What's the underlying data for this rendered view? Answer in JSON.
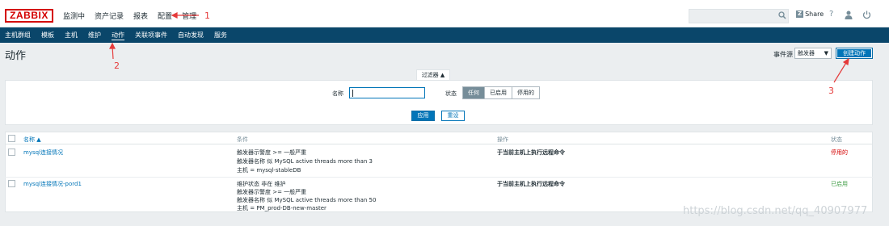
{
  "topbar": {
    "logo": "ZABBIX",
    "menu": [
      "监测中",
      "资产记录",
      "报表",
      "配置",
      "管理"
    ],
    "share_label": "Share",
    "share_badge": "Z",
    "help": "?"
  },
  "subnav": [
    "主机群组",
    "模板",
    "主机",
    "维护",
    "动作",
    "关联项事件",
    "自动发现",
    "服务"
  ],
  "page": {
    "title": "动作",
    "event_source_label": "事件源",
    "event_source_value": "触发器",
    "create_label": "创建动作"
  },
  "filter": {
    "tab_label": "过滤器 ▲",
    "name_label": "名称",
    "name_value": "",
    "status_label": "状态",
    "status_options": [
      "任何",
      "已启用",
      "停用的"
    ],
    "apply_label": "应用",
    "reset_label": "重设"
  },
  "table": {
    "headers": [
      "名称 ▲",
      "条件",
      "操作",
      "状态"
    ],
    "rows": [
      {
        "name": "mysql连接情况",
        "conditions": [
          "触发器示警度 >= 一般严重",
          "触发器名称 似 MySQL active threads more than 3",
          "主机 = mysql-stableDB"
        ],
        "operation": "于当前主机上执行远程命令",
        "status": "停用的"
      },
      {
        "name": "mysql连接情况-pord1",
        "conditions": [
          "维护状态 非在 维护",
          "触发器示警度 >= 一般严重",
          "触发器名称 似 MySQL active threads more than 50",
          "主机 = PM_prod-DB-new-master"
        ],
        "operation": "于当前主机上执行远程命令",
        "status": "已启用"
      }
    ]
  },
  "annotations": [
    "1",
    "2",
    "3"
  ],
  "watermark": "https://blog.csdn.net/qq_40907977",
  "colors": {
    "brand": "#d40000",
    "nav": "#0a466a",
    "primary": "#0275b8",
    "status_disabled": "#d40000",
    "status_enabled": "#429e47",
    "annotation": "#e53a3a"
  }
}
